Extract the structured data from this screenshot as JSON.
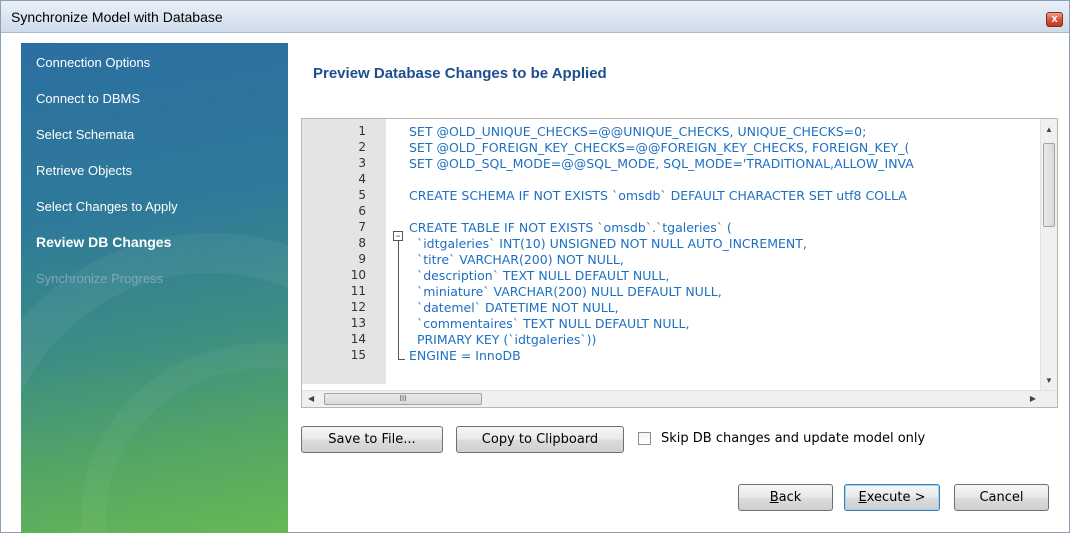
{
  "window": {
    "title": "Synchronize Model with Database",
    "close_label": "x"
  },
  "sidebar": {
    "steps": [
      {
        "label": "Connection Options",
        "state": "done"
      },
      {
        "label": "Connect to DBMS",
        "state": "done"
      },
      {
        "label": "Select Schemata",
        "state": "done"
      },
      {
        "label": "Retrieve Objects",
        "state": "done"
      },
      {
        "label": "Select Changes to Apply",
        "state": "done"
      },
      {
        "label": "Review DB Changes",
        "state": "active"
      },
      {
        "label": "Synchronize Progress",
        "state": "disabled"
      }
    ]
  },
  "main": {
    "heading": "Preview Database Changes to be Applied",
    "editor": {
      "lines": [
        {
          "n": "1",
          "text": "SET @OLD_UNIQUE_CHECKS=@@UNIQUE_CHECKS, UNIQUE_CHECKS=0;"
        },
        {
          "n": "2",
          "text": "SET @OLD_FOREIGN_KEY_CHECKS=@@FOREIGN_KEY_CHECKS, FOREIGN_KEY_("
        },
        {
          "n": "3",
          "text": "SET @OLD_SQL_MODE=@@SQL_MODE, SQL_MODE='TRADITIONAL,ALLOW_INVA"
        },
        {
          "n": "4",
          "text": ""
        },
        {
          "n": "5",
          "text": "CREATE SCHEMA IF NOT EXISTS `omsdb` DEFAULT CHARACTER SET utf8 COLLA"
        },
        {
          "n": "6",
          "text": ""
        },
        {
          "n": "7",
          "text": "CREATE TABLE IF NOT EXISTS `omsdb`.`tgaleries` ("
        },
        {
          "n": "8",
          "text": "  `idtgaleries` INT(10) UNSIGNED NOT NULL AUTO_INCREMENT,"
        },
        {
          "n": "9",
          "text": "  `titre` VARCHAR(200) NOT NULL,"
        },
        {
          "n": "10",
          "text": "  `description` TEXT NULL DEFAULT NULL,"
        },
        {
          "n": "11",
          "text": "  `miniature` VARCHAR(200) NULL DEFAULT NULL,"
        },
        {
          "n": "12",
          "text": "  `datemel` DATETIME NOT NULL,"
        },
        {
          "n": "13",
          "text": "  `commentaires` TEXT NULL DEFAULT NULL,"
        },
        {
          "n": "14",
          "text": "  PRIMARY KEY (`idtgaleries`))"
        },
        {
          "n": "15",
          "text": "ENGINE = InnoDB"
        }
      ],
      "hscroll_grip": "III"
    },
    "save_button": "Save to File...",
    "copy_button": "Copy to Clipboard",
    "skip_checkbox": {
      "label": "Skip DB changes and update model only",
      "checked": false
    }
  },
  "footer": {
    "back": {
      "mnemonic": "B",
      "rest": "ack"
    },
    "execute": {
      "mnemonic": "E",
      "rest": "xecute >"
    },
    "cancel": "Cancel"
  }
}
